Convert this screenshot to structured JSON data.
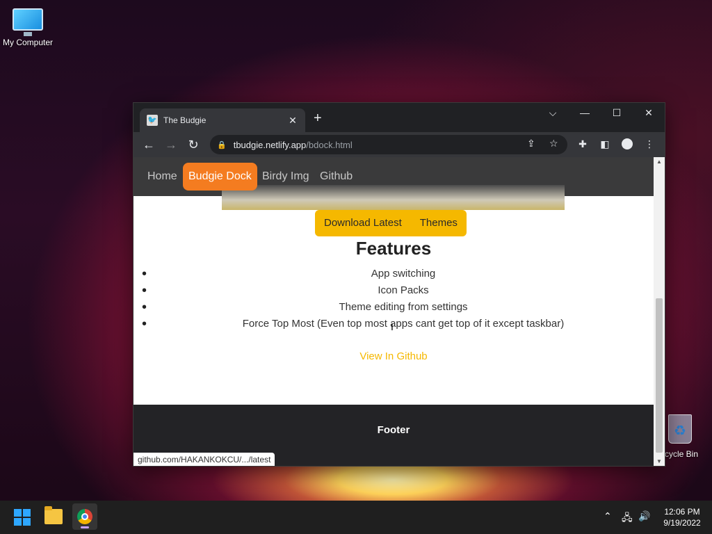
{
  "desktop": {
    "my_computer_label": "My Computer",
    "recycle_bin_label": "cycle Bin"
  },
  "browser": {
    "tab_title": "The Budgie",
    "tab_close": "✕",
    "new_tab": "+",
    "url_host": "tbudgie.netlify.app",
    "url_path": "/bdock.html",
    "status_url": "github.com/HAKANKOKCU/.../latest",
    "controls": {
      "dropdown": "⌵",
      "minimize": "—",
      "maximize": "☐",
      "close": "✕"
    }
  },
  "site": {
    "nav": [
      "Home",
      "Budgie Dock",
      "Birdy Img",
      "Github"
    ],
    "active_nav": "Budgie Dock",
    "buttons": [
      "Download Latest",
      "Themes"
    ],
    "features_title": "Features",
    "features": [
      "App switching",
      "Icon Packs",
      "Theme editing from settings",
      "Force Top Most (Even top most apps cant get top of it except taskbar)"
    ],
    "view_link": "View In Github",
    "footer": "Footer"
  },
  "taskbar": {
    "time": "12:06 PM",
    "date": "9/19/2022"
  },
  "colors": {
    "accent_orange": "#f47c20",
    "button_yellow": "#f5b800",
    "nav_bg": "#3a3a3b",
    "footer_bg": "#232326"
  }
}
